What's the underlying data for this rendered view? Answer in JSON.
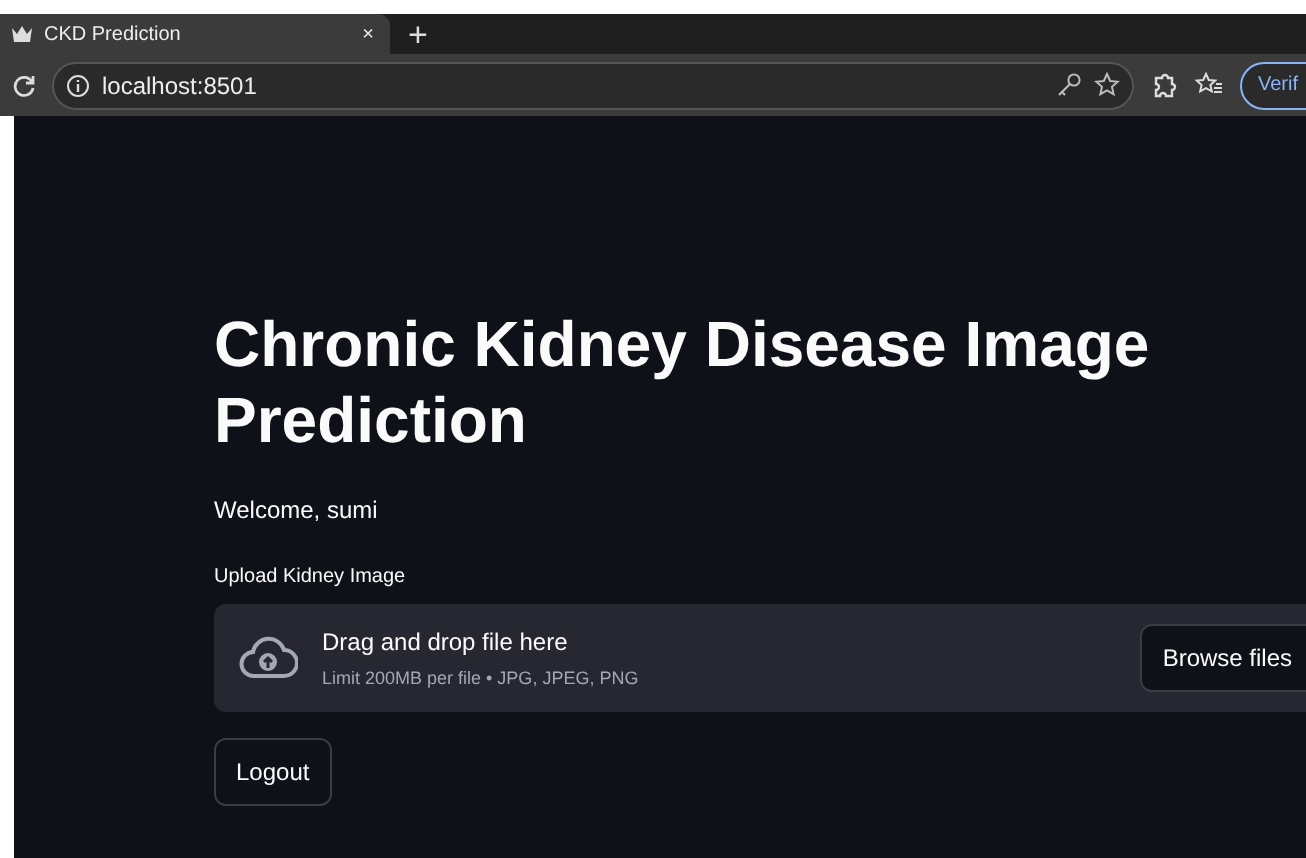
{
  "browser": {
    "tab": {
      "title": "CKD Prediction",
      "close": "×"
    },
    "new_tab": "+",
    "address": "localhost:8501",
    "verify_button": "Verif"
  },
  "page": {
    "title": "Chronic Kidney Disease Image Prediction",
    "welcome": "Welcome, sumi",
    "uploader": {
      "label": "Upload Kidney Image",
      "drop_text": "Drag and drop file here",
      "limit_text": "Limit 200MB per file • JPG, JPEG, PNG",
      "browse_button": "Browse files"
    },
    "logout_button": "Logout"
  }
}
